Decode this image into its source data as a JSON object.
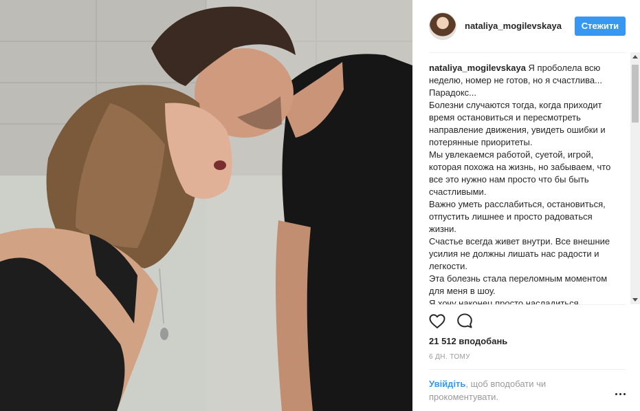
{
  "post": {
    "username": "nataliya_mogilevskaya",
    "follow_label": "Стежити",
    "caption_username": "nataliya_mogilevskaya",
    "caption_lines": [
      "Я проболела всю неделю, номер не готов, но я счастлива... Парадокс...",
      "Болезни случаются тогда, когда приходит время остановиться и пересмотреть направление движения, увидеть ошибки и потерянные приоритеты.",
      "Мы увлекаемся работой, суетой, игрой, которая похожа на жизнь, но забываем, что все это нужно нам просто что бы быть счастливыми.",
      "Важно уметь расслабиться, остановиться, отпустить лишнее и просто радоваться жизни.",
      "Счастье всегда живет внутри. Все внешние усилия не должны лишать нас радости и легкости.",
      "Эта болезнь стала переломным моментом для меня в шоу.",
      "Я хочу наконец просто насладиться"
    ],
    "likes": "21 512 вподобань",
    "time": "6 ДН. ТОМУ",
    "login_link": "Увійдіть",
    "login_rest": ", щоб вподобати чи прокоментувати."
  },
  "icons": {
    "like": "heart-icon",
    "comment": "comment-icon",
    "more": "more-options-icon"
  },
  "colors": {
    "accent": "#3897f0",
    "text": "#262626",
    "muted": "#999999"
  }
}
